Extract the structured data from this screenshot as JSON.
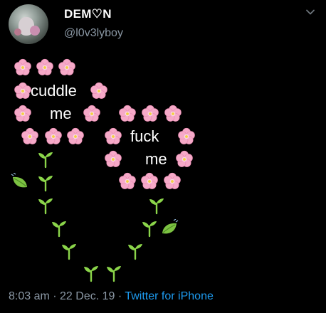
{
  "tweet": {
    "display_name": "DEM♡N",
    "handle": "@l0v3lyboy",
    "words": [
      "cuddle",
      "me",
      "fuck",
      "me"
    ],
    "icons": {
      "flower": "cherry-blossom-icon",
      "sprout": "seedling-icon",
      "leaf": "leaf-fluttering-icon"
    },
    "time": "8:03 am",
    "separator1": " · ",
    "date": "22 Dec. 19",
    "separator2": " · ",
    "source": "Twitter for iPhone"
  },
  "colors": {
    "background": "#000000",
    "text": "#ffffff",
    "secondary": "#8b98a5",
    "link": "#1d9bf0",
    "petal": "#f6a9c8",
    "petal_center": "#f4d03f",
    "sprout": "#8bd54a",
    "leaf": "#7cc242"
  }
}
